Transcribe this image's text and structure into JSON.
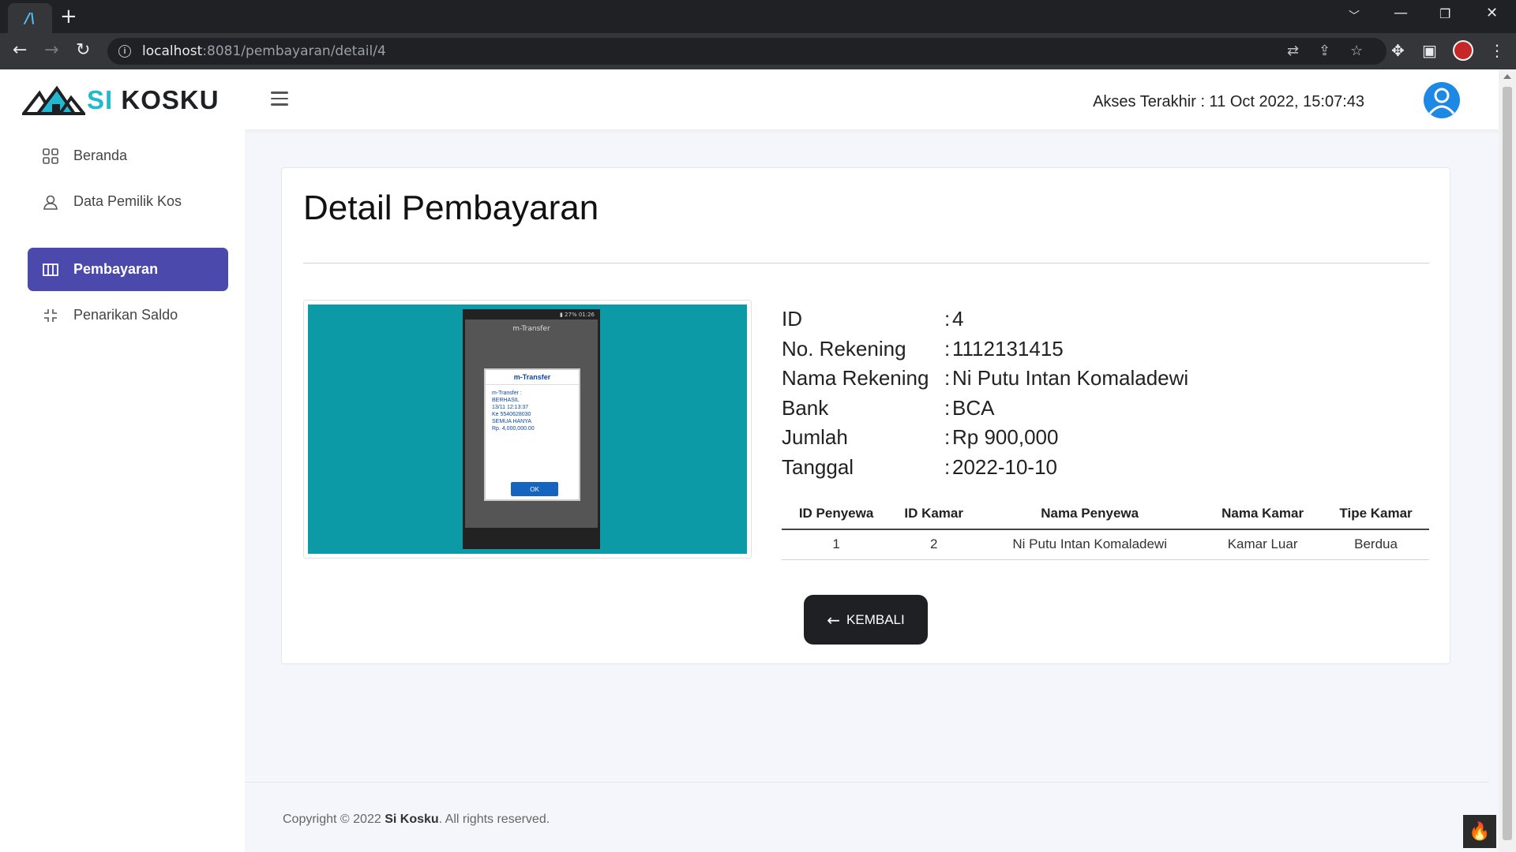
{
  "browser": {
    "url_host": "localhost",
    "url_path": ":8081/pembayaran/detail/4"
  },
  "header": {
    "logo_si": "SI",
    "logo_kosku": "KOSKU",
    "last_access": "Akses Terakhir : 11 Oct 2022, 15:07:43"
  },
  "sidebar": {
    "items": [
      {
        "label": "Beranda",
        "icon": "grid-icon"
      },
      {
        "label": "Data Pemilik Kos",
        "icon": "person-icon"
      },
      {
        "label": "Pembayaran",
        "icon": "columns-icon",
        "active": true
      },
      {
        "label": "Penarikan Saldo",
        "icon": "compress-icon"
      }
    ]
  },
  "main": {
    "title": "Detail Pembayaran",
    "proof_image": {
      "phone_title": "m-Transfer",
      "dialog_title": "m-Transfer",
      "dialog_lines": [
        "m-Transfer :",
        "BERHASIL",
        "13/11 12:13:37",
        "Ke 5540628030",
        "SEMUA HANYA",
        "Rp. 4,000,000.00"
      ],
      "dialog_ok": "OK"
    },
    "details": [
      {
        "label": "ID",
        "value": "4"
      },
      {
        "label": "No. Rekening",
        "value": "1112131415"
      },
      {
        "label": "Nama Rekening",
        "value": "Ni Putu Intan Komaladewi"
      },
      {
        "label": "Bank",
        "value": "BCA"
      },
      {
        "label": "Jumlah",
        "value": "Rp 900,000"
      },
      {
        "label": "Tanggal",
        "value": "2022-10-10"
      }
    ],
    "separator": ":",
    "table": {
      "headers": [
        "ID Penyewa",
        "ID Kamar",
        "Nama Penyewa",
        "Nama Kamar",
        "Tipe Kamar"
      ],
      "rows": [
        [
          "1",
          "2",
          "Ni Putu Intan Komaladewi",
          "Kamar Luar",
          "Berdua"
        ]
      ]
    },
    "back_label": "KEMBALI"
  },
  "footer": {
    "prefix": "Copyright © 2022 ",
    "brand": "Si Kosku",
    "suffix": ". All rights reserved."
  },
  "colors": {
    "accent": "#4b49ac",
    "logo_cyan": "#22b8cf",
    "button_dark": "#1f2024"
  }
}
